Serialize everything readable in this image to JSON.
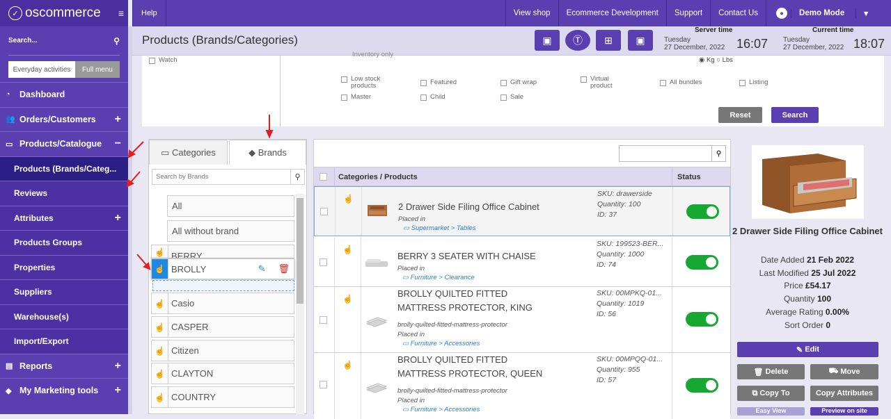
{
  "sidebar": {
    "logo": "oscommerce",
    "search_label": "Search...",
    "tab_everyday": "Everyday activities",
    "tab_full": "Full menu",
    "items": [
      {
        "label": "Dashboard",
        "icon": "dashboard-icon"
      },
      {
        "label": "Orders/Customers",
        "icon": "users-icon"
      },
      {
        "label": "Products/Catalogue",
        "icon": "folder-icon"
      },
      {
        "label": "Products (Brands/Categ...",
        "icon": ""
      },
      {
        "label": "Reviews",
        "icon": ""
      },
      {
        "label": "Attributes",
        "icon": ""
      },
      {
        "label": "Products Groups",
        "icon": ""
      },
      {
        "label": "Properties",
        "icon": ""
      },
      {
        "label": "Suppliers",
        "icon": ""
      },
      {
        "label": "Warehouse(s)",
        "icon": ""
      },
      {
        "label": "Import/Export",
        "icon": ""
      },
      {
        "label": "Reports",
        "icon": "chart-icon"
      },
      {
        "label": "My Marketing tools",
        "icon": "tag-icon"
      }
    ]
  },
  "topbar": {
    "help": "Help",
    "view_shop": "View shop",
    "ecommerce_dev": "Ecommerce Development",
    "support": "Support",
    "contact": "Contact Us",
    "user": "Demo Mode"
  },
  "header": {
    "title": "Products (Brands/Categories)",
    "server_time_label": "Server time",
    "server_day": "Tuesday",
    "server_date": "27 December, 2022",
    "server_time": "16:07",
    "current_time_label": "Current time",
    "current_day": "Tuesday",
    "current_date": "27 December, 2022",
    "current_time": "18:07"
  },
  "filter": {
    "watch": "Watch",
    "inventory_only": "Inventory only",
    "kg": "Kg",
    "lbs": "Lbs",
    "checks_row1": [
      "Low stock products",
      "Featured",
      "Gift wrap",
      "Virtual product",
      "All bundles",
      "Listing"
    ],
    "checks_row2": [
      "Master",
      "Child",
      "Sale"
    ],
    "reset": "Reset",
    "search": "Search"
  },
  "categories_panel": {
    "tab_categories": "Categories",
    "tab_brands": "Brands",
    "search_placeholder": "Search by Brands",
    "brands": [
      "All",
      "All without brand",
      "BERRY",
      "BROLLY",
      "Casio",
      "CASPER",
      "Citizen",
      "CLAYTON",
      "COUNTRY"
    ]
  },
  "products": {
    "col_products": "Categories / Products",
    "col_status": "Status",
    "rows": [
      {
        "name": "2 Drawer Side Filing Office Cabinet",
        "slug": "",
        "placed": "Placed in",
        "path1": "Supermarket",
        "path2": "Tables",
        "sku": "SKU: drawerside",
        "qty": "Quantity: 100",
        "id": "ID: 37"
      },
      {
        "name": "BERRY 3 SEATER WITH CHAISE",
        "slug": "",
        "placed": "Placed in",
        "path1": "Furniture",
        "path2": "Clearance",
        "sku": "SKU: 199523-BER...",
        "qty": "Quantity: 1000",
        "id": "ID: 74"
      },
      {
        "name": "BROLLY QUILTED FITTED MATTRESS PROTECTOR, KING",
        "slug": "brolly-quilted-fitted-mattress-protector",
        "placed": "Placed in",
        "path1": "Furniture",
        "path2": "Accessories",
        "sku": "SKU: 00MPKQ-01...",
        "qty": "Quantity: 1019",
        "id": "ID: 56"
      },
      {
        "name": "BROLLY QUILTED FITTED MATTRESS PROTECTOR, QUEEN",
        "slug": "brolly-quilted-fitted-mattress-protector",
        "placed": "Placed in",
        "path1": "Furniture",
        "path2": "Accessories",
        "sku": "SKU: 00MPQQ-01...",
        "qty": "Quantity: 955",
        "id": "ID: 57"
      }
    ]
  },
  "detail": {
    "title": "2 Drawer Side Filing Office Cabinet",
    "date_added_label": "Date Added",
    "date_added": "21 Feb 2022",
    "last_modified_label": "Last Modified",
    "last_modified": "25 Jul 2022",
    "price_label": "Price",
    "price": "£54.17",
    "quantity_label": "Quantity",
    "quantity": "100",
    "rating_label": "Average Rating",
    "rating": "0.00%",
    "sort_label": "Sort Order",
    "sort": "0",
    "edit": "Edit",
    "delete": "Delete",
    "move": "Move",
    "copy_to": "Copy To",
    "copy_attributes": "Copy Attributes",
    "easy_view": "Easy View",
    "preview": "Preview on site"
  },
  "colors": {
    "primary": "#5a3fb0",
    "toggle_on": "#17a832",
    "link": "#2a7dc9"
  }
}
